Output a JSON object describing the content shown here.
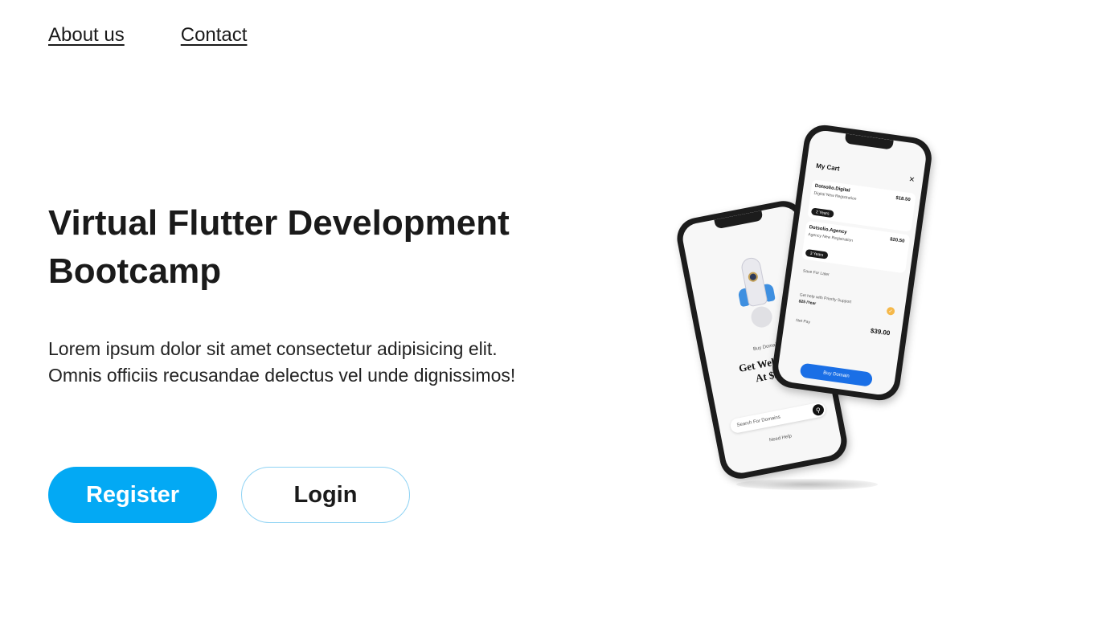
{
  "nav": {
    "about_label": "About us",
    "contact_label": "Contact"
  },
  "hero": {
    "title": "Virtual Flutter Development Bootcamp",
    "description": "Lorem ipsum dolor sit amet consectetur adipisicing elit. Omnis officiis recusandae delectus vel unde dignissimos!",
    "register_label": "Register",
    "login_label": "Login"
  },
  "colors": {
    "accent": "#03a9f4",
    "text": "#1a1a1a",
    "login_border": "#8fd3f4"
  },
  "phone_mockup": {
    "back_screen": {
      "subtitle": "Buy Domain",
      "headline_line1": "Get Web N",
      "headline_line2": "At $5/",
      "search_placeholder": "Search For Domains",
      "help_label": "Need Help"
    },
    "front_screen": {
      "title": "My Cart",
      "items": [
        {
          "name": "Dotsolio.Digital",
          "sub": "Digital New Registration",
          "price": "$18.50",
          "term": "2 Years"
        },
        {
          "name": "Dotsolio.Agency",
          "sub": "Agency New Registration",
          "price": "$20.50",
          "term": "3 Years"
        }
      ],
      "save_later": "Save For Later",
      "priority_line1": "Get help with Priority Support",
      "priority_price": "$25 /Year",
      "net_pay_label": "Net Pay",
      "net_pay_value": "$39.00",
      "buy_label": "Buy Domain"
    }
  }
}
